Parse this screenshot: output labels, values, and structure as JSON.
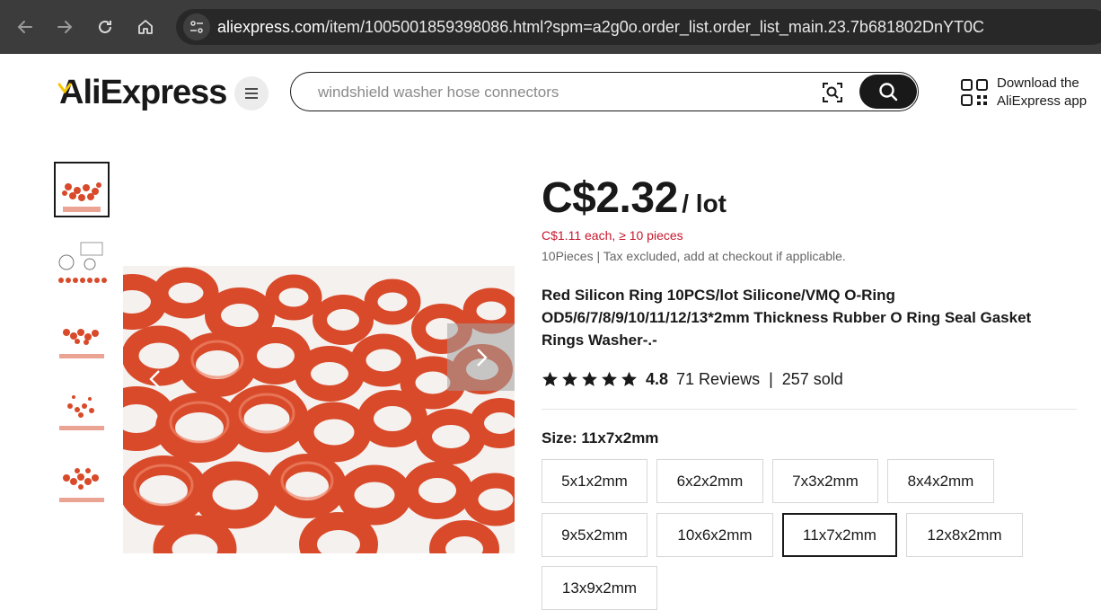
{
  "browser": {
    "url_host": "aliexpress.com",
    "url_path": "/item/1005001859398086.html?spm=a2g0o.order_list.order_list_main.23.7b681802DnYT0C"
  },
  "header": {
    "logo": "AliExpress",
    "search_placeholder": "windshield washer hose connectors",
    "download_line1": "Download the",
    "download_line2": "AliExpress app"
  },
  "gallery": {
    "thumbnail_count": 5,
    "selected_index": 0
  },
  "product": {
    "price": "C$2.32",
    "price_unit": "/ lot",
    "price_each": "C$1.11 each, ≥ 10 pieces",
    "tax_note": "10Pieces | Tax excluded, add at checkout if applicable.",
    "title": "Red Silicon Ring 10PCS/lot Silicone/VMQ O-Ring OD5/6/7/8/9/10/11/12/13*2mm Thickness Rubber O Ring Seal Gasket Rings Washer-.-",
    "rating": "4.8",
    "reviews": "71 Reviews",
    "sold": "257 sold",
    "stars": 5
  },
  "size": {
    "label": "Size: 11x7x2mm",
    "options": [
      "5x1x2mm",
      "6x2x2mm",
      "7x3x2mm",
      "8x4x2mm",
      "9x5x2mm",
      "10x6x2mm",
      "11x7x2mm",
      "12x8x2mm",
      "13x9x2mm"
    ],
    "selected": "11x7x2mm"
  },
  "colors": {
    "accent_red": "#c6162c",
    "ring_orange": "#d84a2a",
    "logo_yellow": "#f7c600",
    "ink": "#191919"
  }
}
